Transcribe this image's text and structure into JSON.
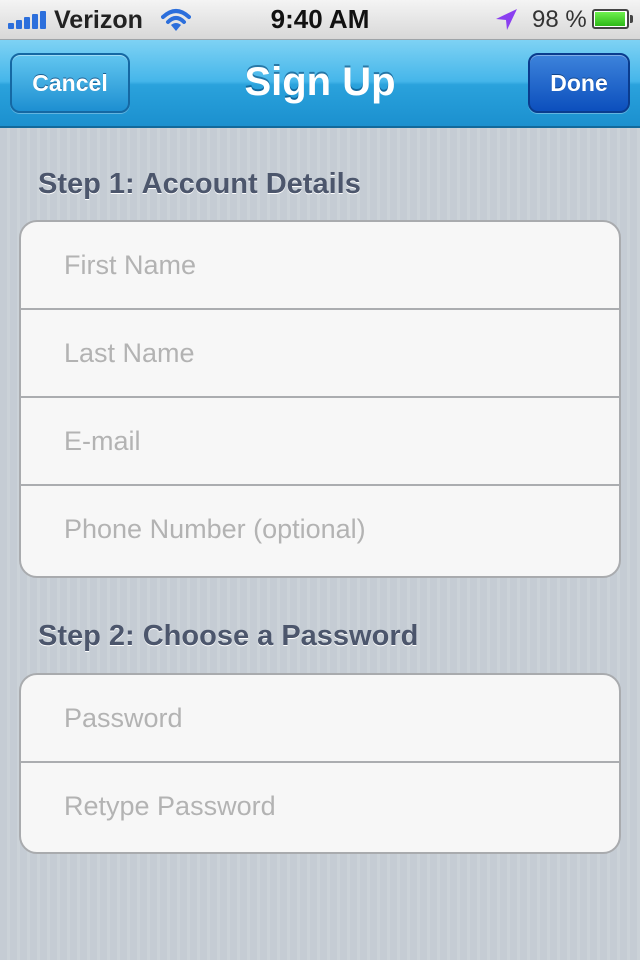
{
  "status_bar": {
    "carrier": "Verizon",
    "signal_bars": 5,
    "time": "9:40 AM",
    "battery_percent_label": "98 %",
    "battery_level": 0.98,
    "icons": [
      "signal-icon",
      "wifi-icon",
      "location-arrow-icon",
      "battery-icon"
    ]
  },
  "nav": {
    "title": "Sign Up",
    "cancel_label": "Cancel",
    "done_label": "Done"
  },
  "section1": {
    "header": "Step 1: Account Details",
    "fields": [
      {
        "placeholder": "First Name",
        "value": ""
      },
      {
        "placeholder": "Last Name",
        "value": ""
      },
      {
        "placeholder": "E-mail",
        "value": ""
      },
      {
        "placeholder": "Phone Number (optional)",
        "value": ""
      }
    ]
  },
  "section2": {
    "header": "Step 2: Choose a Password",
    "fields": [
      {
        "placeholder": "Password",
        "value": ""
      },
      {
        "placeholder": "Retype Password",
        "value": ""
      }
    ]
  },
  "colors": {
    "nav_bar": "#2aa2dc",
    "done_button": "#0c4fbd",
    "cancel_button": "#1d8fd1",
    "section_header": "#4c566c",
    "background": "#c5ccd4",
    "placeholder": "#b3b3b3",
    "battery_fill": "#2db817",
    "location_arrow": "#8a3ff0"
  }
}
